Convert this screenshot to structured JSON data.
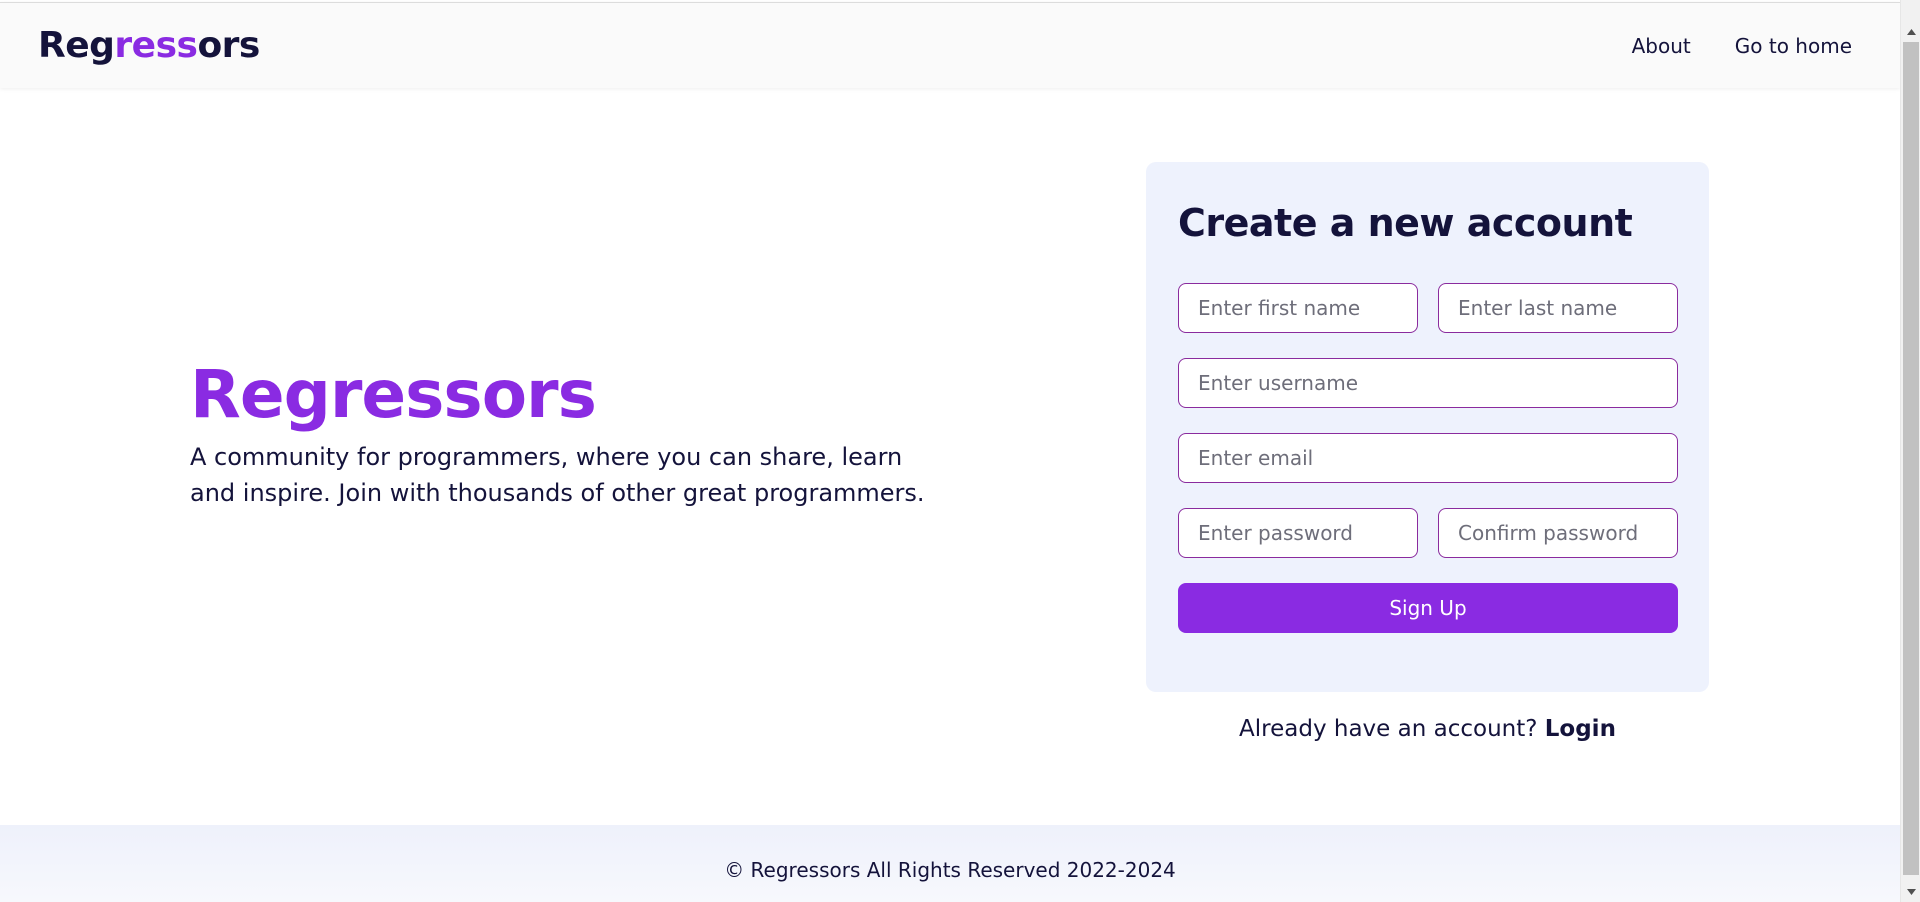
{
  "navbar": {
    "logo_parts": [
      "Reg",
      "ress",
      "ors"
    ],
    "links": [
      {
        "label": "About"
      },
      {
        "label": "Go to home"
      }
    ]
  },
  "hero": {
    "title": "Regressors",
    "description": "A community for programmers, where you can share, learn and inspire. Join with thousands of other great programmers."
  },
  "form": {
    "title": "Create a new account",
    "first_name_placeholder": "Enter first name",
    "last_name_placeholder": "Enter last name",
    "username_placeholder": "Enter username",
    "email_placeholder": "Enter email",
    "password_placeholder": "Enter password",
    "confirm_password_placeholder": "Confirm password",
    "submit_label": "Sign Up"
  },
  "login_prompt": {
    "text": "Already have an account? ",
    "link_label": "Login"
  },
  "footer": {
    "text": "© Regressors All Rights Reserved 2022-2024"
  },
  "icons": {
    "scroll_up": "scroll-up-arrow-icon",
    "scroll_down": "scroll-down-arrow-icon"
  },
  "colors": {
    "brand": "#8a2be2",
    "text": "#14133b",
    "card_bg": "#eef2fd",
    "input_border": "#8a2b9e"
  }
}
